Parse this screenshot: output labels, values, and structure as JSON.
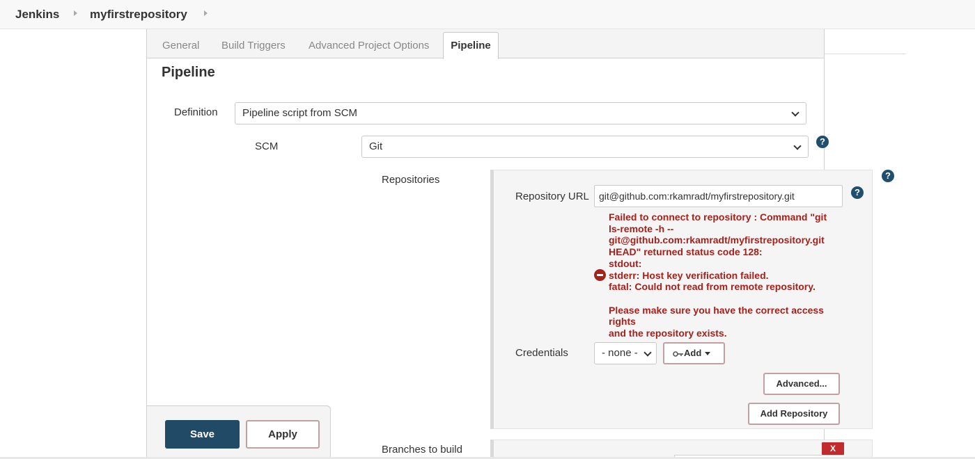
{
  "breadcrumb": {
    "items": [
      "Jenkins",
      "myfirstrepository"
    ]
  },
  "tabs": {
    "general": "General",
    "build_triggers": "Build Triggers",
    "advanced_project_options": "Advanced Project Options",
    "pipeline": "Pipeline"
  },
  "section": {
    "title": "Pipeline"
  },
  "definition": {
    "label": "Definition",
    "value": "Pipeline script from SCM"
  },
  "scm": {
    "label": "SCM",
    "value": "Git",
    "help": "?"
  },
  "repositories": {
    "label": "Repositories",
    "help": "?",
    "url_label": "Repository URL",
    "url_value": "git@github.com:rkamradt/myfirstrepository.git",
    "url_help": "?",
    "error": "Failed to connect to repository : Command \"git\nls-remote -h --\ngit@github.com:rkamradt/myfirstrepository.git\nHEAD\" returned status code 128:\nstdout:\nstderr: Host key verification failed.\nfatal: Could not read from remote repository.\n\nPlease make sure you have the correct access\nrights\nand the repository exists.",
    "credentials_label": "Credentials",
    "credentials_value": "- none -",
    "add_label": "Add",
    "advanced_label": "Advanced...",
    "add_repository_label": "Add Repository"
  },
  "branches": {
    "label": "Branches to build",
    "remove_label": "X"
  },
  "actions": {
    "save_label": "Save",
    "apply_label": "Apply"
  },
  "colors": {
    "error": "#a8201a",
    "primary": "#204a66",
    "help": "#1f4e6e"
  }
}
